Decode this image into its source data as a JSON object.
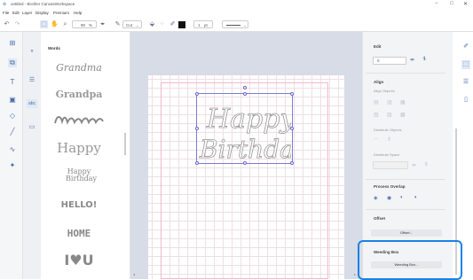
{
  "window": {
    "title": "untitled - Brother CanvasWorkspace",
    "controls": [
      "−",
      "□",
      "✕"
    ]
  },
  "menu": [
    "File",
    "Edit",
    "Layer",
    "Display",
    "Premium",
    "Help"
  ],
  "toolbar": {
    "zoom": "90",
    "zoom_unit": "%",
    "mode": "Cut",
    "line_width": "1",
    "line_unit": "pt"
  },
  "words_panel": {
    "title": "Words",
    "items": [
      "Grandma",
      "Grandpa",
      "Happy",
      "Happy Birthday",
      "HELLO!",
      "HOME",
      "I♥U"
    ]
  },
  "canvas": {
    "design_text": [
      "Happy",
      "Birthday"
    ]
  },
  "edit_panel": {
    "title": "Edit",
    "align_title": "Align",
    "align_objects": "Align Objects",
    "distribute_objects": "Distribute Objects",
    "distribute_space": "Distribute Space",
    "process_overlap": "Process Overlap",
    "offset_title": "Offset",
    "offset_button": "Offset...",
    "weld_title": "Weeding Box",
    "weld_button": "Weeding Box..."
  },
  "colors": {
    "accent": "#4a6fa8",
    "highlight": "#1a82e6",
    "selection": "#7d7ad6"
  }
}
